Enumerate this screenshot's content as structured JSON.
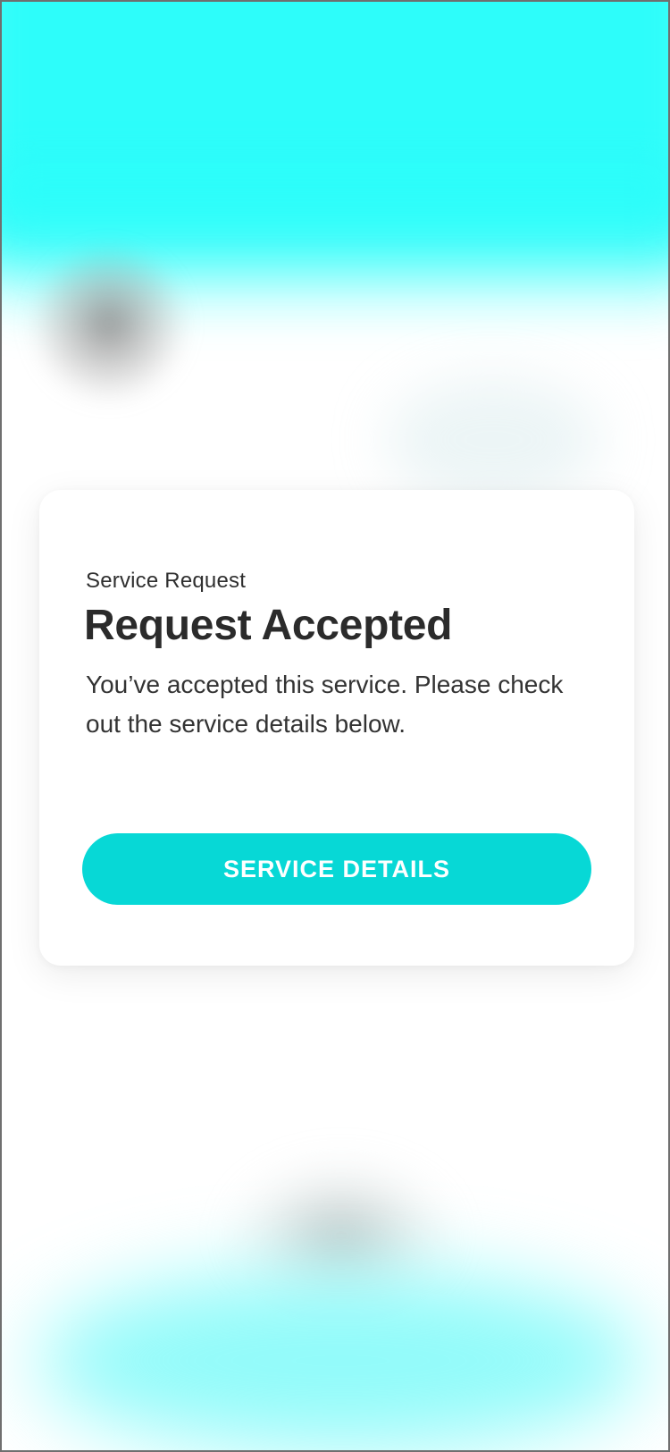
{
  "card": {
    "eyebrow": "Service Request",
    "title": "Request Accepted",
    "description": "You’ve accepted this service. Please check out the service details below.",
    "button_label": "SERVICE DETAILS"
  },
  "colors": {
    "accent": "#07d8d6",
    "background_top": "#2dfdfa",
    "text_primary": "#2b2b2b",
    "card_background": "#ffffff"
  }
}
